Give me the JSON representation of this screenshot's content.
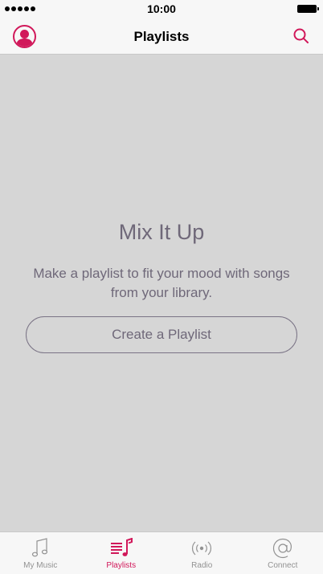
{
  "status_bar": {
    "time": "10:00"
  },
  "nav": {
    "title": "Playlists"
  },
  "empty_state": {
    "title": "Mix It Up",
    "message": "Make a playlist to fit your mood with songs from your library.",
    "button_label": "Create a Playlist"
  },
  "tabs": [
    {
      "label": "My Music",
      "icon": "music-note-icon",
      "active": false
    },
    {
      "label": "Playlists",
      "icon": "playlist-icon",
      "active": true
    },
    {
      "label": "Radio",
      "icon": "radio-icon",
      "active": false
    },
    {
      "label": "Connect",
      "icon": "at-sign-icon",
      "active": false
    }
  ],
  "colors": {
    "accent": "#d1185a",
    "inactive": "#929292",
    "text_muted": "#6f6879"
  }
}
